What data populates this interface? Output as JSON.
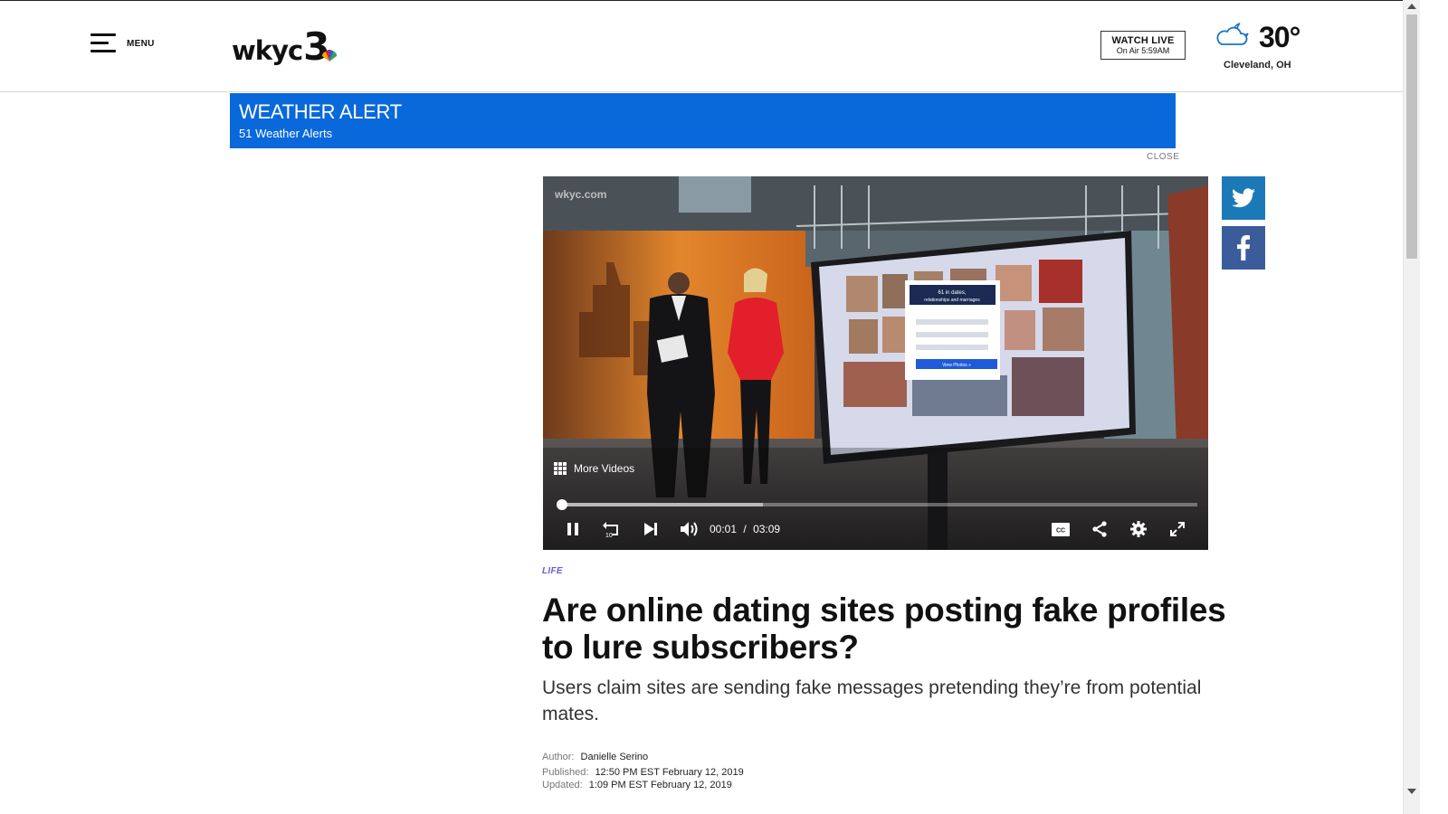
{
  "header": {
    "menu_label": "MENU",
    "logo_text": "wkyc",
    "logo_number": "3",
    "watch_live": {
      "title": "WATCH LIVE",
      "subtitle": "On Air 5:59AM"
    },
    "weather": {
      "temperature": "30°",
      "city": "Cleveland, OH",
      "icon": "partly-cloudy-night-icon"
    }
  },
  "alert": {
    "title": "WEATHER ALERT",
    "subtitle": "51 Weather Alerts",
    "close_label": "CLOSE",
    "color": "#0a69da"
  },
  "social": {
    "twitter_icon": "twitter-icon",
    "facebook_icon": "facebook-icon",
    "twitter_color": "#1b79b8",
    "facebook_color": "#3b5c9a"
  },
  "video": {
    "watermark": "wkyc.com",
    "more_videos_label": "More Videos",
    "current_time": "00:01",
    "separator": "/",
    "duration": "03:09",
    "progress_fraction": 0.005,
    "buffered_fraction": 0.32,
    "screen": {
      "title_line1": "61 in dates,",
      "title_line2": "relationships and marriages",
      "button_label": "View Photos »"
    },
    "controls": [
      "pause-icon",
      "replay-10-icon",
      "skip-next-icon",
      "volume-icon",
      "closed-captions-icon",
      "share-icon",
      "settings-icon",
      "fullscreen-icon"
    ]
  },
  "article": {
    "category": "LIFE",
    "headline": "Are online dating sites posting fake profiles to lure subscribers?",
    "subheadline": "Users claim sites are sending fake messages pretending they’re from potential mates.",
    "author_label": "Author:",
    "author": "Danielle Serino",
    "published_label": "Published:",
    "published": "12:50 PM EST February 12, 2019",
    "updated_label": "Updated:",
    "updated": "1:09 PM EST February 12, 2019"
  }
}
